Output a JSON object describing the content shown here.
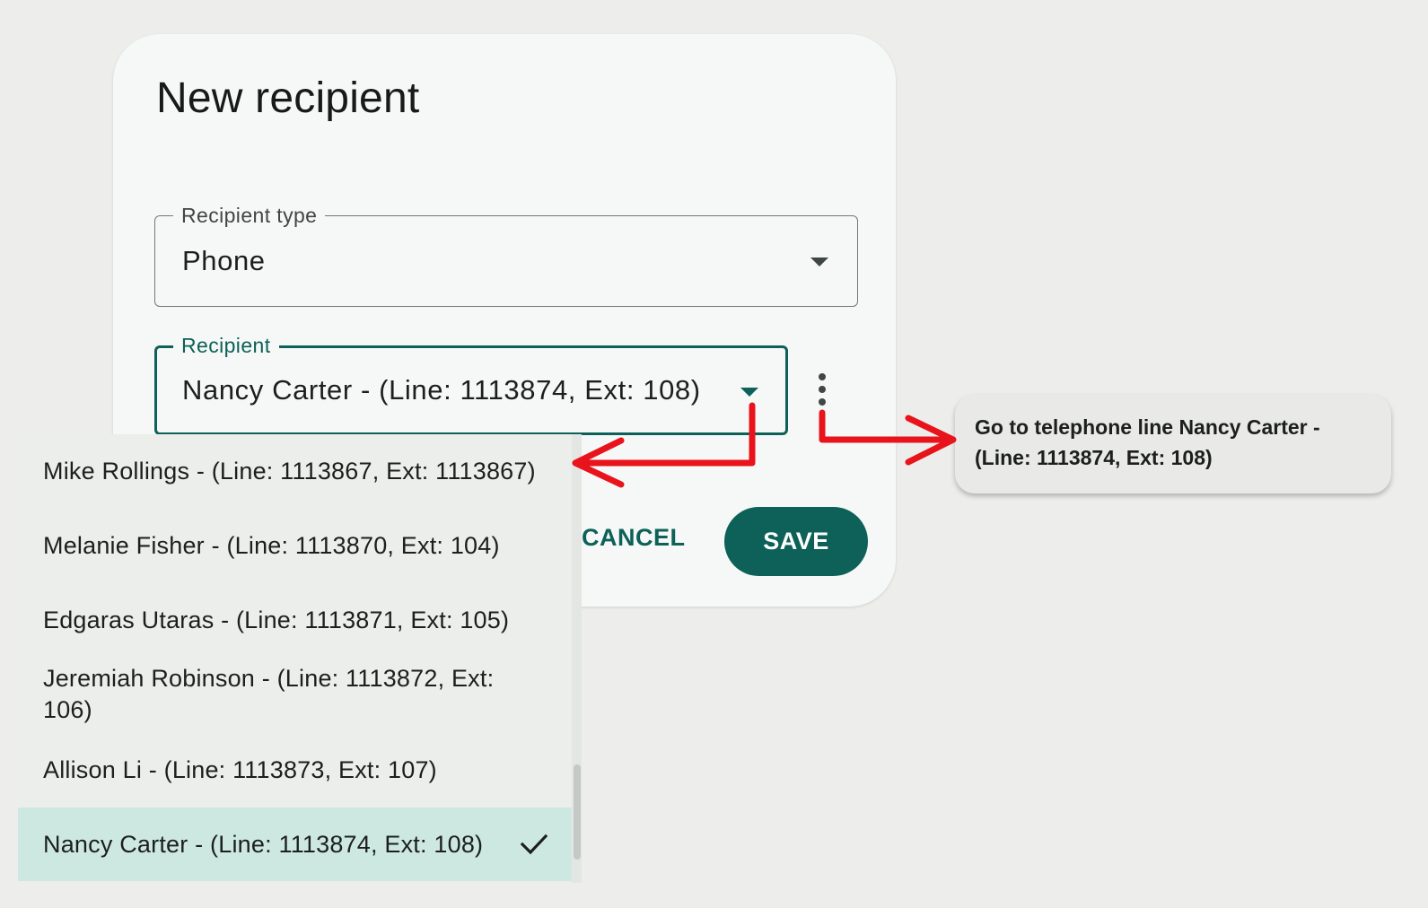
{
  "dialog": {
    "title": "New recipient",
    "recipient_type": {
      "label": "Recipient type",
      "value": "Phone"
    },
    "recipient": {
      "label": "Recipient",
      "value": "Nancy Carter - (Line: 1113874, Ext: 108)"
    },
    "cancel_label": "CANCEL",
    "save_label": "SAVE"
  },
  "dropdown": {
    "items": [
      {
        "label": "Mike Rollings - (Line: 1113867, Ext: 1113867)",
        "selected": false
      },
      {
        "label": "Melanie Fisher - (Line: 1113870, Ext: 104)",
        "selected": false
      },
      {
        "label": "Edgaras Utaras - (Line: 1113871, Ext: 105)",
        "selected": false
      },
      {
        "label": "Jeremiah Robinson  - (Line: 1113872, Ext: 106)",
        "selected": false
      },
      {
        "label": "Allison Li - (Line: 1113873, Ext: 107)",
        "selected": false
      },
      {
        "label": "Nancy Carter - (Line: 1113874, Ext: 108)",
        "selected": true
      }
    ]
  },
  "tooltip": {
    "text": "Go to telephone line Nancy Carter - (Line: 1113874, Ext: 108)"
  },
  "colors": {
    "accent": "#0d6158",
    "selected_item": "#cde8e1",
    "annotation_arrow": "#e8131b"
  },
  "icons": [
    "dropdown-caret-icon",
    "more-vert-icon",
    "check-icon"
  ]
}
